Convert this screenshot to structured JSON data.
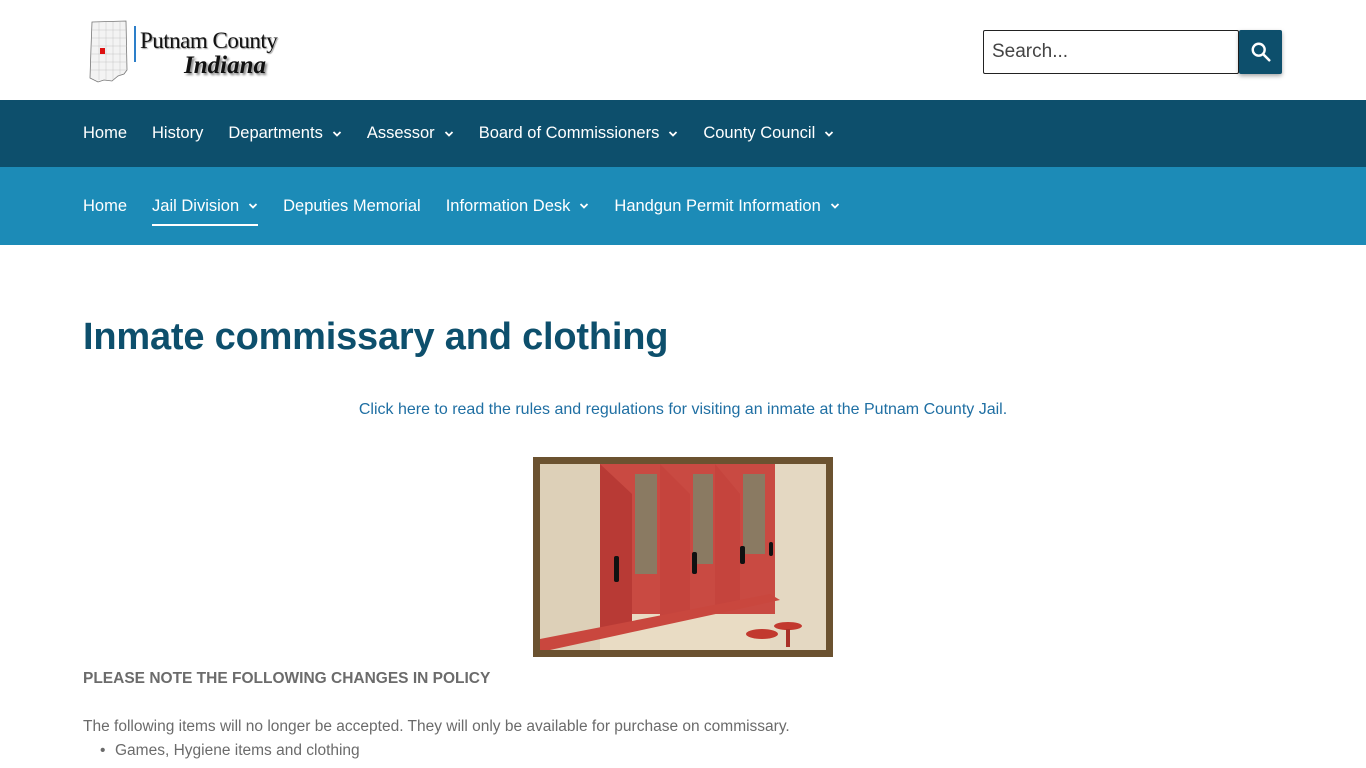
{
  "header": {
    "logo": {
      "line1": "Putnam County",
      "line2": "Indiana"
    },
    "search": {
      "placeholder": "Search...",
      "button_icon": "search-icon"
    }
  },
  "nav_primary": {
    "items": [
      {
        "label": "Home",
        "has_dropdown": false
      },
      {
        "label": "History",
        "has_dropdown": false
      },
      {
        "label": "Departments",
        "has_dropdown": true
      },
      {
        "label": "Assessor",
        "has_dropdown": true
      },
      {
        "label": "Board of Commissioners",
        "has_dropdown": true
      },
      {
        "label": "County Council",
        "has_dropdown": true
      }
    ]
  },
  "nav_secondary": {
    "items": [
      {
        "label": "Home",
        "has_dropdown": false
      },
      {
        "label": "Jail Division",
        "has_dropdown": true,
        "active": true
      },
      {
        "label": "Deputies Memorial",
        "has_dropdown": false
      },
      {
        "label": "Information Desk",
        "has_dropdown": true
      },
      {
        "label": "Handgun Permit Information",
        "has_dropdown": true
      }
    ]
  },
  "main": {
    "title": "Inmate commissary and clothing",
    "rules_link": "Click here to read the rules and regulations for visiting an inmate at the Putnam County Jail.",
    "policy_heading": "PLEASE NOTE THE FOLLOWING CHANGES IN POLICY",
    "policy_text": "The following items will no longer be accepted. They will only be available for purchase on commissary.",
    "policy_items": [
      "Games, Hygiene items and clothing"
    ]
  },
  "colors": {
    "primary_nav": "#0d4f6c",
    "secondary_nav": "#1c8bb7",
    "title": "#0d4f6c",
    "link": "#1f6fa3",
    "body_text": "#6b6b6b"
  }
}
